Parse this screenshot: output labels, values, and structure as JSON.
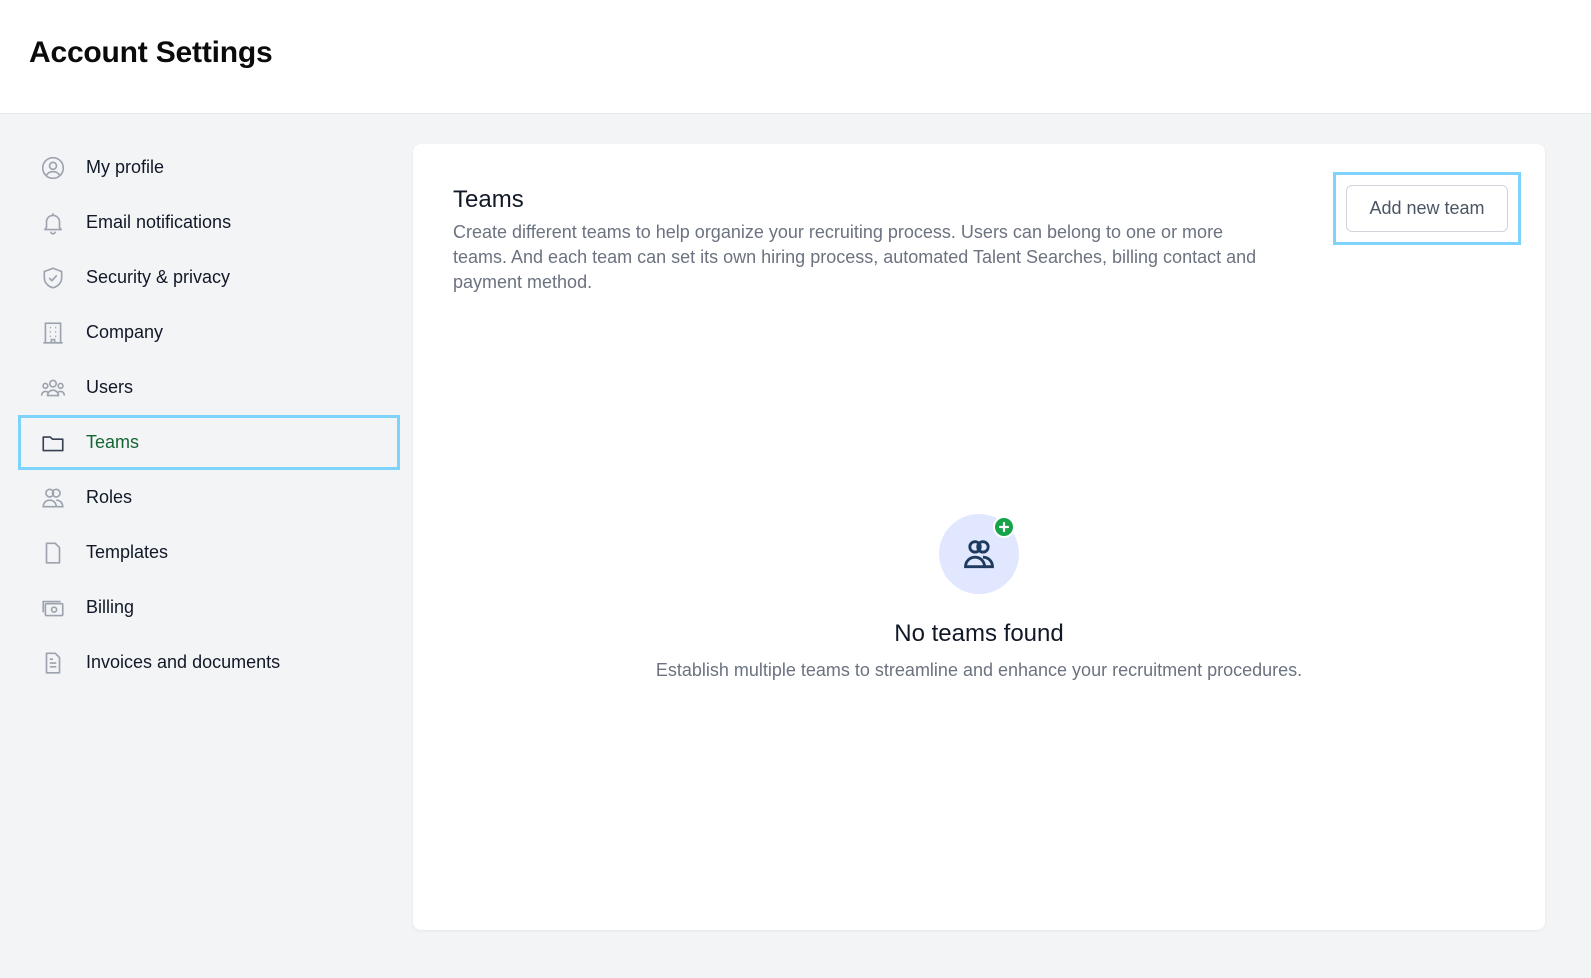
{
  "header": {
    "title": "Account Settings"
  },
  "sidebar": {
    "items": [
      {
        "label": "My profile",
        "icon": "user-circle-icon"
      },
      {
        "label": "Email notifications",
        "icon": "bell-icon"
      },
      {
        "label": "Security & privacy",
        "icon": "shield-icon"
      },
      {
        "label": "Company",
        "icon": "building-icon"
      },
      {
        "label": "Users",
        "icon": "users-icon"
      },
      {
        "label": "Teams",
        "icon": "folder-icon",
        "active": true
      },
      {
        "label": "Roles",
        "icon": "user-group-icon"
      },
      {
        "label": "Templates",
        "icon": "document-icon"
      },
      {
        "label": "Billing",
        "icon": "cash-icon"
      },
      {
        "label": "Invoices and documents",
        "icon": "document-text-icon"
      }
    ]
  },
  "main": {
    "title": "Teams",
    "description": "Create different teams to help organize your recruiting process. Users can belong to one or more teams. And each team can set its own hiring process, automated Talent Searches, billing contact and payment method.",
    "add_button_label": "Add new team",
    "empty_state": {
      "icon": "user-group-add-icon",
      "title": "No teams found",
      "description": "Establish multiple teams to streamline and enhance your recruitment procedures."
    }
  },
  "colors": {
    "accent_highlight": "#7dd3fc",
    "active_label": "#166534",
    "badge_green": "#16a34a",
    "empty_icon_bg": "#e0e7ff"
  }
}
